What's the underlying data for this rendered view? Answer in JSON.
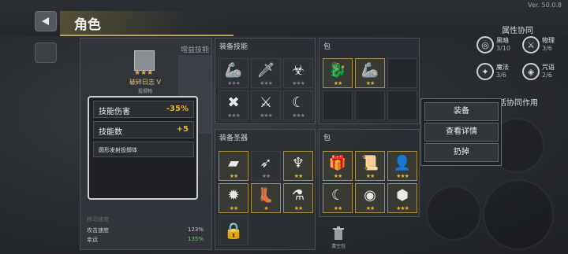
{
  "version": "Ver. 50.0.8",
  "header": {
    "title": "角色",
    "back_icon": "back-triangle-icon"
  },
  "synergy": {
    "title": "属性协同",
    "items": [
      {
        "name": "黑暗",
        "count": "3/10",
        "icon": "swirl-icon"
      },
      {
        "name": "物理",
        "count": "3/6",
        "icon": "sword-icon"
      },
      {
        "name": "魔法",
        "count": "3/6",
        "icon": "magic-star-icon"
      },
      {
        "name": "咒语",
        "count": "2/6",
        "icon": "spell-eye-icon"
      }
    ],
    "combo_title": "高活协同作用"
  },
  "character": {
    "tab_label": "增益技能",
    "stars": "★★★",
    "name": "破碎日志 V",
    "subtitle": "投掷物",
    "stats": [
      {
        "label": "移动速度",
        "value": "",
        "dim": true
      },
      {
        "label": "攻击速度",
        "value": "123%",
        "green": false
      },
      {
        "label": "幸运",
        "value": "135%",
        "green": true
      }
    ]
  },
  "tooltip": {
    "rows": [
      {
        "label": "技能伤害",
        "value": "-35%"
      },
      {
        "label": "技能数",
        "value": "+5"
      }
    ],
    "desc": "圆形发射投掷体"
  },
  "equip_skills": {
    "title": "装备技能",
    "slots": [
      {
        "glyph": "🦾",
        "stars": "★★★",
        "gold": false
      },
      {
        "glyph": "🗡",
        "stars": "★★★",
        "gold": false
      },
      {
        "glyph": "☣",
        "stars": "★★★",
        "gold": false
      },
      {
        "glyph": "✖",
        "stars": "★★★",
        "gold": false
      },
      {
        "glyph": "⚔",
        "stars": "★★★",
        "gold": false
      },
      {
        "glyph": "☾",
        "stars": "★★★",
        "gold": false
      }
    ]
  },
  "bag_skills": {
    "title": "包",
    "slots": [
      {
        "glyph": "🐉",
        "stars": "★★",
        "gold": true
      },
      {
        "glyph": "🦾",
        "stars": "★★",
        "gold": true
      }
    ]
  },
  "equip_relics": {
    "title": "装备圣器",
    "slots": [
      {
        "glyph": "▰",
        "stars": "★★",
        "gold": true
      },
      {
        "glyph": "➶",
        "stars": "★★",
        "gold": false
      },
      {
        "glyph": "♆",
        "stars": "★★",
        "gold": true
      },
      {
        "glyph": "✹",
        "stars": "★★",
        "gold": true
      },
      {
        "glyph": "👢",
        "stars": "★",
        "gold": true
      },
      {
        "glyph": "⚗",
        "stars": "★★",
        "gold": true
      },
      {
        "glyph": "🔒",
        "stars": "",
        "gold": false
      }
    ]
  },
  "bag_relics": {
    "title": "包",
    "slots": [
      {
        "glyph": "🎁",
        "stars": "★★",
        "gold": true
      },
      {
        "glyph": "📜",
        "stars": "★★",
        "gold": true
      },
      {
        "glyph": "👤",
        "stars": "★★★",
        "gold": true
      },
      {
        "glyph": "☾",
        "stars": "★★",
        "gold": true
      },
      {
        "glyph": "◉",
        "stars": "★★",
        "gold": true
      },
      {
        "glyph": "⬢",
        "stars": "★★★",
        "gold": true
      }
    ]
  },
  "context_menu": {
    "equip": "装备",
    "details": "查看详情",
    "discard": "扔掉"
  },
  "trash": {
    "label": "清空包"
  }
}
